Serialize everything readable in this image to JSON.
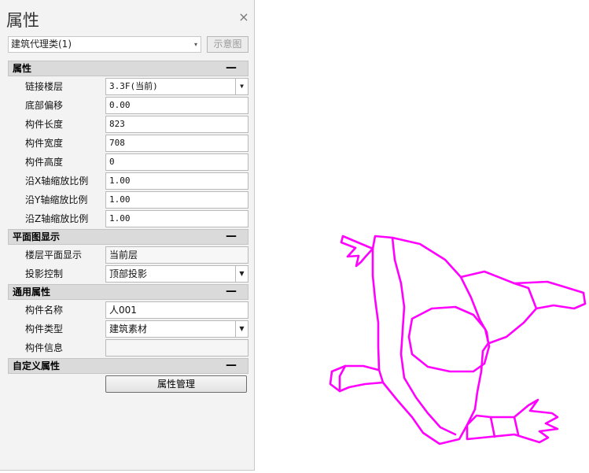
{
  "panel": {
    "title": "属性",
    "close_glyph": "×",
    "type_selector": "建筑代理类(1)",
    "type_arrow": "▾",
    "diagram_button": "示意图"
  },
  "sections": {
    "props": {
      "title": "属性",
      "collapse": "—",
      "rows": {
        "floor": {
          "label": "链接楼层",
          "value": "3.3F(当前)"
        },
        "base_offset": {
          "label": "底部偏移",
          "value": "0.00"
        },
        "length": {
          "label": "构件长度",
          "value": "823"
        },
        "width": {
          "label": "构件宽度",
          "value": "708"
        },
        "height": {
          "label": "构件高度",
          "value": "0"
        },
        "scale_x": {
          "label": "沿X轴缩放比例",
          "value": "1.00"
        },
        "scale_y": {
          "label": "沿Y轴缩放比例",
          "value": "1.00"
        },
        "scale_z": {
          "label": "沿Z轴缩放比例",
          "value": "1.00"
        }
      }
    },
    "plan": {
      "title": "平面图显示",
      "collapse": "—",
      "rows": {
        "floor_display": {
          "label": "楼层平面显示",
          "value": "当前层"
        },
        "projection": {
          "label": "投影控制",
          "value": "顶部投影"
        }
      }
    },
    "common": {
      "title": "通用属性",
      "collapse": "—",
      "rows": {
        "name": {
          "label": "构件名称",
          "value": "人001"
        },
        "type": {
          "label": "构件类型",
          "value": "建筑素材"
        },
        "info": {
          "label": "构件信息",
          "value": ""
        }
      }
    },
    "custom": {
      "title": "自定义属性",
      "collapse": "—",
      "manage_button": "属性管理"
    }
  },
  "dropdown_glyph": "▼",
  "colors": {
    "figure_stroke": "#ff00ff",
    "panel_bg": "#f3f3f3",
    "section_bg": "#dadada"
  }
}
